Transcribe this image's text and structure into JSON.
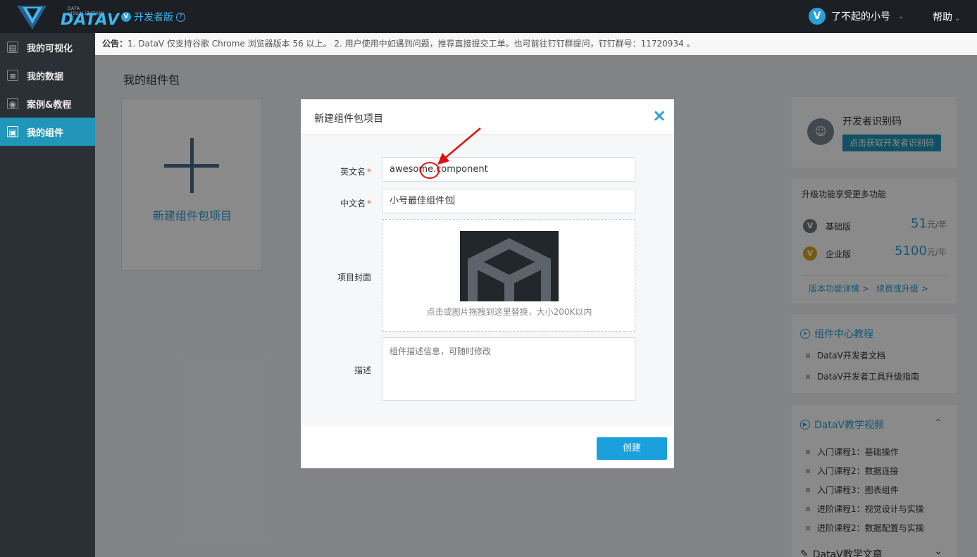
{
  "topbar": {
    "logo_text": "DATAV",
    "logo_sub": "DATA VISUALIZATION",
    "dev_mode": "开发者版",
    "dev_badge": "V",
    "help_icon": "?",
    "user_badge": "V",
    "user_name": "了不起的小号",
    "help": "帮助"
  },
  "sidebar": {
    "items": [
      {
        "label": "我的可视化",
        "icon": "chart-icon"
      },
      {
        "label": "我的数据",
        "icon": "database-icon"
      },
      {
        "label": "案例&教程",
        "icon": "case-icon"
      },
      {
        "label": "我的组件",
        "icon": "cube-icon",
        "active": true
      }
    ]
  },
  "notice": {
    "prefix": "公告：",
    "text": "1. DataV 仅支持谷歌 Chrome 浏览器版本 56 以上。 2. 用户使用中如遇到问题，推荐直接提交工单。也可前往钉钉群提问，钉钉群号：11720934 。"
  },
  "main": {
    "page_title": "我的组件包",
    "new_card_label": "新建组件包项目"
  },
  "right": {
    "dev_code": {
      "title": "开发者识别码",
      "button": "点击获取开发者识别码"
    },
    "upgrade": {
      "title": "升级功能享受更多功能",
      "plans": [
        {
          "name": "基础版",
          "price": "51",
          "unit": "元/年",
          "badge": "V",
          "color": "#6f7780"
        },
        {
          "name": "企业版",
          "price": "5100",
          "unit": "元/年",
          "badge": "V",
          "color": "#d9a520"
        }
      ],
      "link_details": "版本功能详情 >",
      "link_renew": "续费或升级 >"
    },
    "tutorial": {
      "title": "组件中心教程",
      "items": [
        "DataV开发者文档",
        "DataV开发者工具升级指南"
      ]
    },
    "videos": {
      "title": "DataV教学视频",
      "items": [
        "入门课程1：基础操作",
        "入门课程2：数据连接",
        "入门课程3：图表组件",
        "进阶课程1：视觉设计与实操",
        "进阶课程2：数据配置与实操"
      ]
    },
    "articles": {
      "title": "DataV教学文章"
    }
  },
  "modal": {
    "title": "新建组件包项目",
    "close": "×",
    "english_label": "英文名",
    "english_value": "awesome.component",
    "chinese_label": "中文名",
    "chinese_value": "小号最佳组件包",
    "cover_label": "项目封面",
    "cover_hint": "点击或图片拖拽到这里替换，大小200K以内",
    "desc_label": "描述",
    "desc_placeholder": "组件描述信息，可随时修改",
    "required_mark": "*",
    "create_button": "创建"
  },
  "colors": {
    "accent": "#2196b8",
    "link": "#2a9fd6",
    "annotation": "#e01010"
  }
}
